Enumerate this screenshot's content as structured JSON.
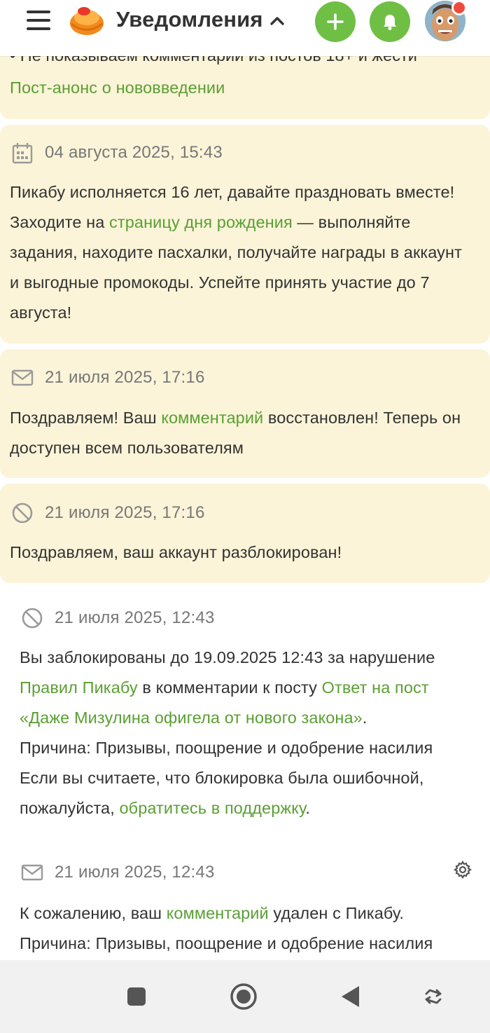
{
  "header": {
    "title": "Уведомления",
    "accent_color": "#6fbf45",
    "icons": [
      "menu-icon",
      "pikabu-logo",
      "chevron-up-icon",
      "plus-icon",
      "bell-icon",
      "avatar"
    ]
  },
  "notifications": [
    {
      "partial_text": "• Не показываем комментарии из постов 18+ и жести",
      "link": "Пост-анонс о нововведении"
    },
    {
      "icon": "calendar-icon",
      "date": "04 августа 2025, 15:43",
      "text_1": "Пикабу исполняется 16 лет, давайте праздновать вместе! Заходите на ",
      "link": "страницу дня рождения",
      "text_2": " — выполняйте задания, находите пасхалки, получайте награды в аккаунт и выгодные промокоды. Успейте принять участие до 7 августа!"
    },
    {
      "icon": "envelope-icon",
      "date": "21 июля 2025, 17:16",
      "text_1": "Поздравляем! Ваш ",
      "link": "комментарий",
      "text_2": " восстановлен! Теперь он доступен всем пользователям"
    },
    {
      "icon": "ban-icon",
      "date": "21 июля 2025, 17:16",
      "text": "Поздравляем, ваш аккаунт разблокирован!"
    },
    {
      "icon": "ban-icon",
      "date": "21 июля 2025, 12:43",
      "text_1": "Вы заблокированы до 19.09.2025 12:43 за нарушение ",
      "link_1": "Правил Пикабу",
      "text_2": " в комментарии к посту ",
      "link_2": "Ответ на пост «Даже Мизулина офигела от нового закона»",
      "text_3": ".",
      "reason": "Причина: Призывы, поощрение и одобрение насилия",
      "text_4": "Если вы считаете, что блокировка была ошибочной, пожалуйста, ",
      "link_3": "обратитесь в поддержку",
      "text_5": "."
    },
    {
      "icon": "envelope-icon",
      "date": "21 июля 2025, 12:43",
      "text_1": "К сожалению, ваш ",
      "link": "комментарий",
      "text_2": " удален с Пикабу.",
      "reason": "Причина: Призывы, поощрение и одобрение насилия"
    }
  ],
  "bottom_nav": [
    "recent-apps-icon",
    "home-icon",
    "back-icon",
    "rotate-icon"
  ],
  "colors": {
    "card_background": "#fbf4d8",
    "link": "#5a9f33",
    "date_text": "#777777",
    "nav_background": "#f1f1f1"
  }
}
